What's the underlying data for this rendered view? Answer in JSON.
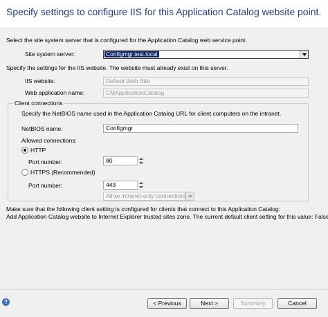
{
  "header": {
    "title": "Specify settings to configure IIS for this Application Catalog website point."
  },
  "intro_text": "Select the site system server that is configured for the Application Catalog web service point.",
  "site_system_server": {
    "label": "Site system server:",
    "value": "Configmgr.test.local"
  },
  "iis_intro": "Specify the settings for the IIS website. The website must already exist on this server.",
  "iis_website": {
    "label": "IIS website:",
    "value": "Default Web Site"
  },
  "web_app_name": {
    "label": "Web application name:",
    "value": "CMApplicationCatalog"
  },
  "client_connections": {
    "legend": "Client connections",
    "description": "Specify the NetBIOS name used in the Application Catalog URL for client computers on the intranet.",
    "netbios": {
      "label": "NetBIOS name:",
      "value": "Configmgr"
    },
    "allowed_label": "Allowed connections:",
    "http": {
      "label": "HTTP",
      "checked": true,
      "port_label": "Port number:",
      "port_value": "80"
    },
    "https": {
      "label": "HTTPS (Recommended)",
      "checked": false,
      "port_label": "Port number:",
      "port_value": "443",
      "dropdown_value": "Allow intranet-only connections"
    }
  },
  "notice_line1": "Make sure that the following client setting is configured for clients that connect to this Application Catalog:",
  "notice_line2": "Add Application Catalog website to Internet Explorer trusted sites zone. The current default client setting for this value: False",
  "footer": {
    "help_glyph": "?",
    "previous": "< Previous",
    "next": "Next >",
    "summary": "Summary",
    "cancel": "Cancel"
  },
  "colors": {
    "title": "#1f3b8c",
    "selection": "#0a246a",
    "background": "#f0f0f0"
  }
}
